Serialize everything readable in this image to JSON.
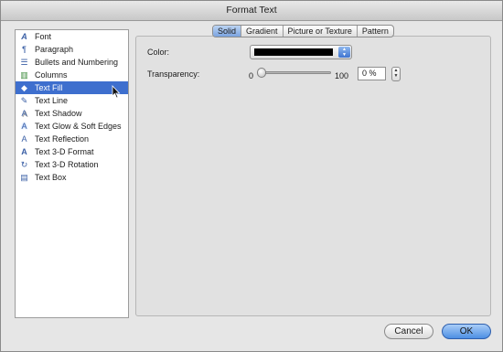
{
  "window": {
    "title": "Format Text"
  },
  "sidebar": {
    "items": [
      {
        "label": "Font",
        "icon": "font-a-icon",
        "glyph": "A"
      },
      {
        "label": "Paragraph",
        "icon": "paragraph-icon",
        "glyph": "¶"
      },
      {
        "label": "Bullets and Numbering",
        "icon": "bullets-icon",
        "glyph": "☰"
      },
      {
        "label": "Columns",
        "icon": "columns-icon",
        "glyph": "▥"
      },
      {
        "label": "Text Fill",
        "icon": "paint-bucket-icon",
        "glyph": "◆"
      },
      {
        "label": "Text Line",
        "icon": "pencil-icon",
        "glyph": "✎"
      },
      {
        "label": "Text Shadow",
        "icon": "text-shadow-a-icon",
        "glyph": "A"
      },
      {
        "label": "Text Glow & Soft Edges",
        "icon": "text-glow-a-icon",
        "glyph": "A"
      },
      {
        "label": "Text Reflection",
        "icon": "text-reflection-a-icon",
        "glyph": "A"
      },
      {
        "label": "Text 3-D Format",
        "icon": "text-3d-format-a-icon",
        "glyph": "A"
      },
      {
        "label": "Text 3-D Rotation",
        "icon": "text-3d-rotation-icon",
        "glyph": "↻"
      },
      {
        "label": "Text Box",
        "icon": "text-box-icon",
        "glyph": "▤"
      }
    ],
    "selected": "Text Fill"
  },
  "tabs": [
    "Solid",
    "Gradient",
    "Picture or Texture",
    "Pattern"
  ],
  "active_tab": "Solid",
  "solid": {
    "color_label": "Color:",
    "color_value": "#000000",
    "transparency_label": "Transparency:",
    "slider_min": "0",
    "slider_max": "100",
    "transparency_value": "0 %",
    "transparency_level": 0
  },
  "buttons": {
    "cancel": "Cancel",
    "ok": "OK"
  }
}
